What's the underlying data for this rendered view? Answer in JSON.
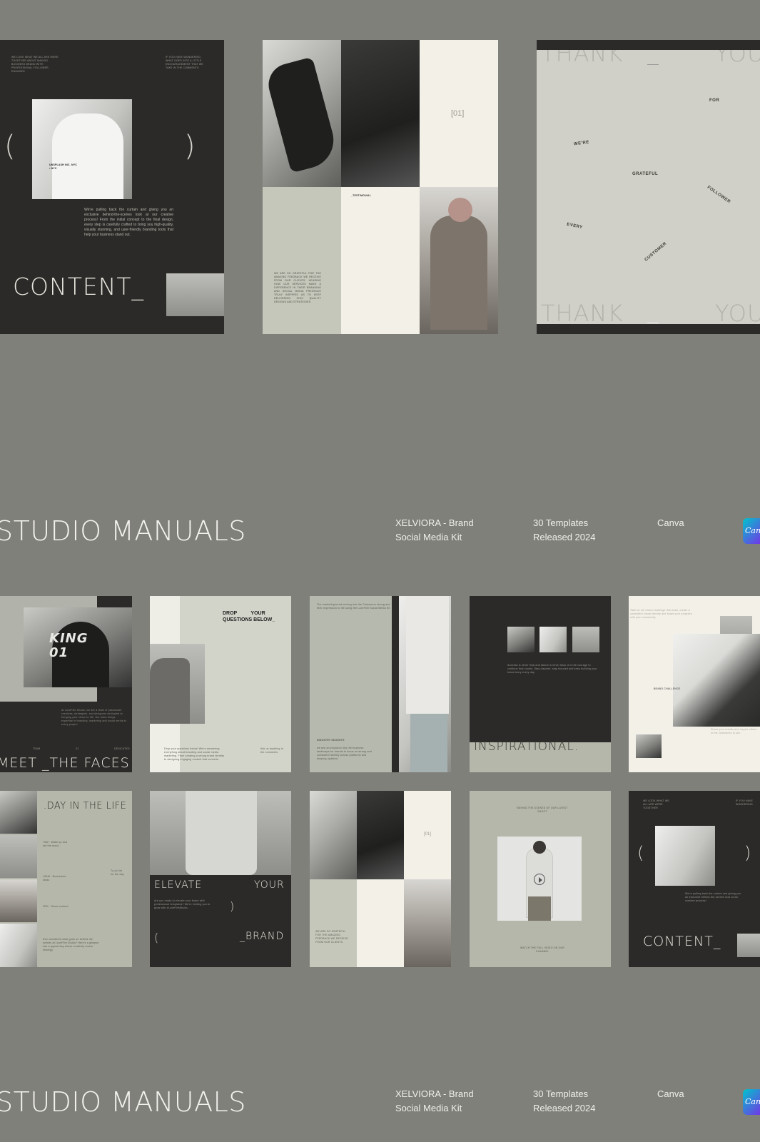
{
  "top_row": {
    "content_card": {
      "paren_left": "(",
      "paren_right": ")",
      "shirt_text": "UNSPLASH INC.\nNYC • NYC",
      "body": "We're pulling back the curtain and giving you an exclusive behind-the-scenes look at our creative process! From the initial concept to the final design, every step is carefully crafted to bring you high-quality, visually stunning, and user-friendly branding tools that help your business stand out.",
      "title": "CONTENT_"
    },
    "testimonial_card": {
      "number": "[01]",
      "label": "_TESTIMONIAL",
      "body": "WE ARE SO GRATEFUL FOR THE AMAZING FEEDBACK WE RECEIVE FROM OUR CLIENTS. HEARING HOW OUR SERVICES MAKE A DIFFERENCE IN THEIR BRANDING AND SOCIAL MEDIA PRESENCE TRULY INSPIRES US TO KEEP DELIVERING HIGH QUALITY DESIGNS AND STRATEGIES."
    },
    "thankyou_card": {
      "top_left": "THANK",
      "top_right": "YOU",
      "bottom_left": "THANK",
      "bottom_right": "YOU",
      "words": [
        "FOR",
        "WE'RE",
        "GRATEFUL",
        "FOLLOWER",
        "EVERY",
        "CUSTOMER"
      ]
    }
  },
  "sections": [
    {
      "title": "STUDIO MANUALS",
      "product_line1": "XELVIORA - Brand",
      "product_line2": "Social Media Kit",
      "count_line1": "30 Templates",
      "count_line2": "Released 2024",
      "platform": "Canva",
      "badge": "Canva"
    },
    {
      "title": "STUDIO MANUALS",
      "product_line1": "XELVIORA - Brand",
      "product_line2": "Social Media Kit",
      "count_line1": "30 Templates",
      "count_line2": "Released 2024",
      "platform": "Canva",
      "badge": "Canva"
    }
  ],
  "grid": {
    "faces": {
      "title": "MEET _THE FACES",
      "team": "TEAM",
      "num": "01",
      "dedicated": "DEDICATED",
      "jersey": "KING\n01"
    },
    "questions": {
      "title": "DROP          YOUR\nQUESTIONS BELOW_"
    },
    "inspirational": {
      "title": "INSPIRATIONAL."
    },
    "brand_challenge": {
      "label": "BRAND CHALLENGE"
    },
    "day_life": {
      "title": ".DAY IN THE LIFE"
    },
    "elevate": {
      "word1": "ELEVATE",
      "word2": "YOUR",
      "word3": "_BRAND",
      "paren_open": "(",
      "paren_close": ")"
    },
    "testimonial_small": {
      "number": "[01]"
    },
    "content_small": {
      "title": "CONTENT_",
      "paren_left": "(",
      "paren_right": ")"
    }
  }
}
